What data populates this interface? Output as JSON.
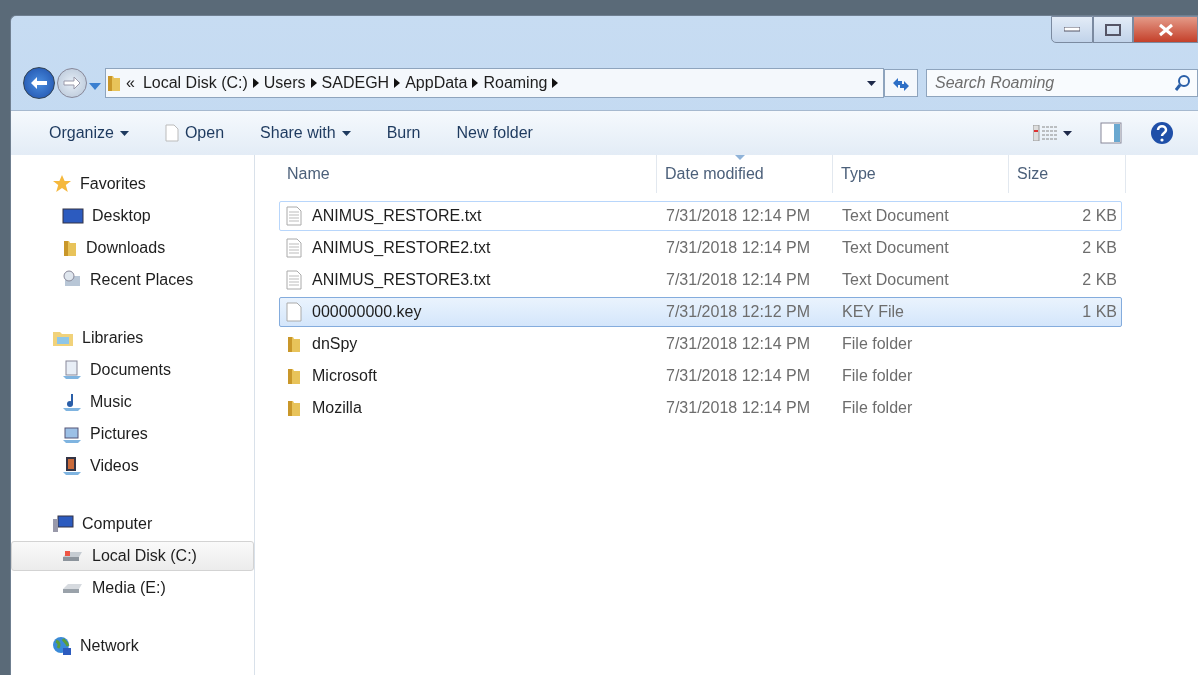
{
  "address": {
    "overflow": "«",
    "crumbs": [
      "Local Disk (C:)",
      "Users",
      "SADEGH",
      "AppData",
      "Roaming"
    ]
  },
  "search": {
    "placeholder": "Search Roaming"
  },
  "toolbar": [
    {
      "label": "Organize",
      "dropdown": true,
      "kind": "menu"
    },
    {
      "label": "Open",
      "dropdown": false,
      "kind": "open"
    },
    {
      "label": "Share with",
      "dropdown": true,
      "kind": "menu"
    },
    {
      "label": "Burn",
      "dropdown": false,
      "kind": "menu"
    },
    {
      "label": "New folder",
      "dropdown": false,
      "kind": "menu"
    }
  ],
  "sidebar": [
    {
      "label": "Favorites",
      "selected": false,
      "children": [
        {
          "label": "Desktop",
          "selected": false
        },
        {
          "label": "Downloads",
          "selected": false
        },
        {
          "label": "Recent Places",
          "selected": false
        }
      ]
    },
    {
      "label": "Libraries",
      "selected": false,
      "children": [
        {
          "label": "Documents",
          "selected": false
        },
        {
          "label": "Music",
          "selected": false
        },
        {
          "label": "Pictures",
          "selected": false
        },
        {
          "label": "Videos",
          "selected": false
        }
      ]
    },
    {
      "label": "Computer",
      "selected": false,
      "children": [
        {
          "label": "Local Disk (C:)",
          "selected": true
        },
        {
          "label": "Media (E:)",
          "selected": false
        }
      ]
    },
    {
      "label": "Network",
      "selected": false
    }
  ],
  "table": {
    "columns": [
      "Name",
      "Date modified",
      "Type",
      "Size"
    ],
    "rows": [
      {
        "kind": "text",
        "name": "ANIMUS_RESTORE.txt",
        "date": "7/31/2018 12:14 PM",
        "type": "Text Document",
        "size": "2 KB",
        "selected": false,
        "focused": true
      },
      {
        "kind": "text",
        "name": "ANIMUS_RESTORE2.txt",
        "date": "7/31/2018 12:14 PM",
        "type": "Text Document",
        "size": "2 KB",
        "selected": false,
        "focused": false
      },
      {
        "kind": "text",
        "name": "ANIMUS_RESTORE3.txt",
        "date": "7/31/2018 12:14 PM",
        "type": "Text Document",
        "size": "2 KB",
        "selected": false,
        "focused": false
      },
      {
        "kind": "blank",
        "name": "000000000.key",
        "date": "7/31/2018 12:12 PM",
        "type": "KEY File",
        "size": "1 KB",
        "selected": true,
        "focused": false
      },
      {
        "kind": "folder",
        "name": "dnSpy",
        "date": "7/31/2018 12:14 PM",
        "type": "File folder",
        "selected": false,
        "focused": false
      },
      {
        "kind": "folder",
        "name": "Microsoft",
        "date": "7/31/2018 12:14 PM",
        "type": "File folder",
        "selected": false,
        "focused": false
      },
      {
        "kind": "folder",
        "name": "Mozilla",
        "date": "7/31/2018 12:14 PM",
        "type": "File folder",
        "selected": false,
        "focused": false
      }
    ]
  }
}
